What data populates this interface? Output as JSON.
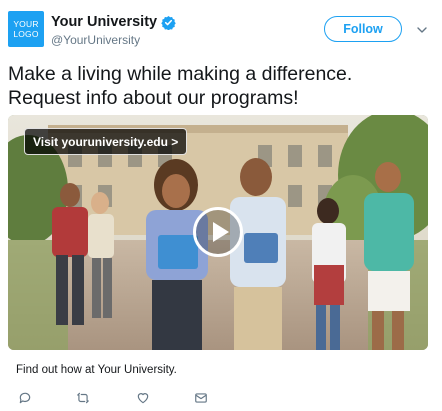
{
  "account": {
    "logo_line1": "YOUR",
    "logo_line2": "LOGO",
    "display_name": "Your University",
    "handle": "@YourUniversity",
    "follow_label": "Follow"
  },
  "tweet": {
    "text_line1": "Make a living while making a difference.",
    "text_line2": "Request info about our programs!"
  },
  "media": {
    "url_label": "Visit youruniversity.edu >"
  },
  "card": {
    "caption": "Find out how at Your University."
  },
  "icons": {
    "verified": "verified-badge-icon",
    "more": "chevron-down-icon",
    "play": "play-icon",
    "reply": "reply-icon",
    "retweet": "retweet-icon",
    "like": "heart-icon",
    "message": "envelope-icon"
  },
  "colors": {
    "accent": "#1da1f2",
    "text": "#14171a",
    "muted": "#657786"
  }
}
